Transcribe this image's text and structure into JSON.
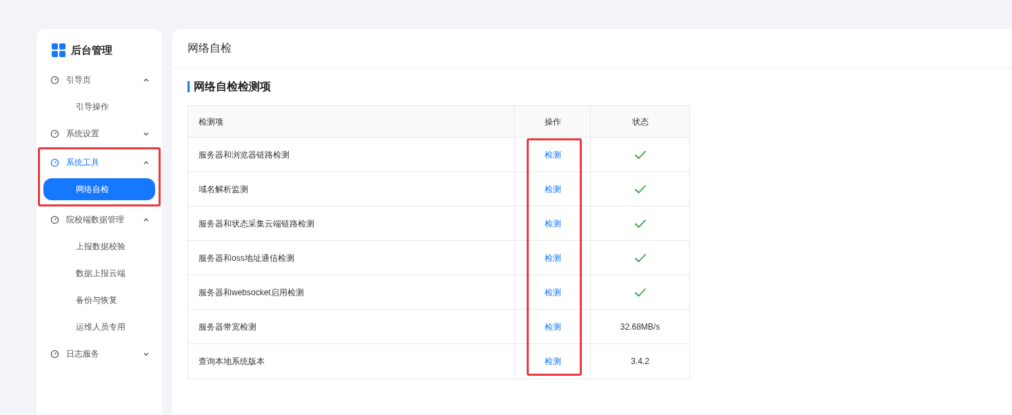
{
  "sidebar": {
    "title": "后台管理",
    "groups": [
      {
        "label": "引导页",
        "expanded": true,
        "selected": false,
        "highlighted": false,
        "children": [
          {
            "label": "引导操作",
            "selected": false
          }
        ]
      },
      {
        "label": "系统设置",
        "expanded": false,
        "selected": false,
        "highlighted": false
      },
      {
        "label": "系统工具",
        "expanded": true,
        "selected": true,
        "highlighted": true,
        "children": [
          {
            "label": "网络自检",
            "selected": true
          }
        ]
      },
      {
        "label": "院校端数据管理",
        "expanded": true,
        "selected": false,
        "highlighted": false,
        "children": [
          {
            "label": "上报数据校验",
            "selected": false
          },
          {
            "label": "数据上报云端",
            "selected": false
          },
          {
            "label": "备份与恢复",
            "selected": false
          },
          {
            "label": "运维人员专用",
            "selected": false
          }
        ]
      },
      {
        "label": "日志服务",
        "expanded": false,
        "selected": false,
        "highlighted": false
      }
    ]
  },
  "page_title": "网络自检",
  "section_title": "网络自检检测项",
  "table": {
    "columns": [
      {
        "label": "检测项",
        "highlighted": false
      },
      {
        "label": "操作",
        "highlighted": true
      },
      {
        "label": "状态",
        "highlighted": false
      }
    ],
    "rows": [
      {
        "item": "服务器和浏览器链路检测",
        "action": "检测",
        "status": {
          "kind": "check"
        }
      },
      {
        "item": "域名解析监测",
        "action": "检测",
        "status": {
          "kind": "check"
        }
      },
      {
        "item": "服务器和状态采集云端链路检测",
        "action": "检测",
        "status": {
          "kind": "check"
        }
      },
      {
        "item": "服务器和oss地址通信检测",
        "action": "检测",
        "status": {
          "kind": "check"
        }
      },
      {
        "item": "服务器和websocket启用检测",
        "action": "检测",
        "status": {
          "kind": "check"
        }
      },
      {
        "item": "服务器带宽检测",
        "action": "检测",
        "status": {
          "kind": "text",
          "text": "32.68MB/s"
        }
      },
      {
        "item": "查询本地系统版本",
        "action": "检测",
        "status": {
          "kind": "text",
          "text": "3.4.2"
        }
      }
    ]
  }
}
